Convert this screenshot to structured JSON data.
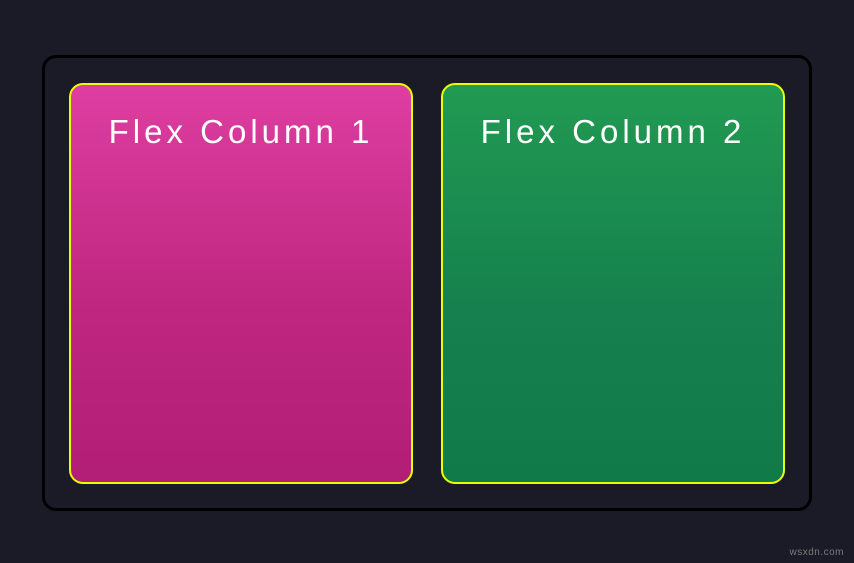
{
  "columns": [
    {
      "label": "Flex Column 1"
    },
    {
      "label": "Flex Column 2"
    }
  ],
  "watermark": "wsxdn.com"
}
